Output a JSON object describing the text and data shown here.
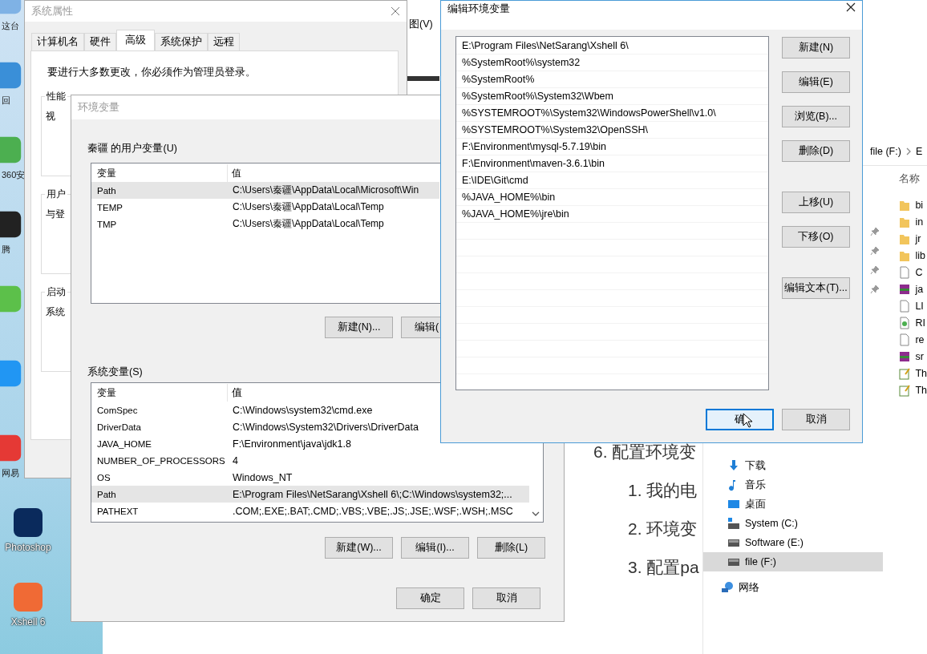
{
  "desktop_icons": [
    {
      "label": "这台",
      "color": "#7fb2e5"
    },
    {
      "label": "回",
      "color": "#3a8fd8"
    },
    {
      "label": "360安",
      "color": "#4caf50"
    },
    {
      "label": "腾",
      "color": "#222222"
    },
    {
      "color": "#5cc04a"
    },
    {
      "color": "#2196f3"
    },
    {
      "label": "网易",
      "color": "#e53935"
    },
    {
      "label": "Photoshop",
      "color": "#0a2a5c"
    },
    {
      "label": "Xshell 6",
      "color": "#f06a35"
    }
  ],
  "document": {
    "menu_label": "图(V)",
    "heading": "6. 配置环境变",
    "steps": [
      "1. 我的电",
      "2. 环境变",
      "3. 配置pa"
    ]
  },
  "explorer": {
    "breadcrumb": [
      "file (F:)",
      "E"
    ],
    "column_header": "名称",
    "files": [
      {
        "name": "bi",
        "kind": "folder"
      },
      {
        "name": "in",
        "kind": "folder"
      },
      {
        "name": "jr",
        "kind": "folder"
      },
      {
        "name": "lib",
        "kind": "folder"
      },
      {
        "name": "C",
        "kind": "file"
      },
      {
        "name": "ja",
        "kind": "archive"
      },
      {
        "name": "LI",
        "kind": "file"
      },
      {
        "name": "RI",
        "kind": "web"
      },
      {
        "name": "re",
        "kind": "file"
      },
      {
        "name": "sr",
        "kind": "archive"
      },
      {
        "name": "Th",
        "kind": "text"
      },
      {
        "name": "Th",
        "kind": "text"
      }
    ],
    "nav_items": [
      {
        "label": "下载",
        "kind": "download",
        "selected": false
      },
      {
        "label": "音乐",
        "kind": "music",
        "selected": false
      },
      {
        "label": "桌面",
        "kind": "desktop",
        "selected": false
      },
      {
        "label": "System (C:)",
        "kind": "system-drive",
        "selected": false
      },
      {
        "label": "Software (E:)",
        "kind": "drive",
        "selected": false
      },
      {
        "label": "file (F:)",
        "kind": "drive",
        "selected": true
      }
    ],
    "network": {
      "label": "网络"
    }
  },
  "system_properties": {
    "title": "系统属性",
    "tabs": [
      {
        "label": "计算机名",
        "selected": false
      },
      {
        "label": "硬件",
        "selected": false
      },
      {
        "label": "高级",
        "selected": true
      },
      {
        "label": "系统保护",
        "selected": false
      },
      {
        "label": "远程",
        "selected": false
      }
    ],
    "notice": "要进行大多数更改，你必须作为管理员登录。",
    "groups": [
      {
        "label": "性能",
        "text": "视"
      },
      {
        "label": "用户",
        "text": "与登"
      },
      {
        "label": "启动",
        "text": "系统"
      }
    ]
  },
  "env_vars": {
    "title": "环境变量",
    "user_label": "秦疆 的用户变量(U)",
    "user_columns": [
      "变量",
      "值"
    ],
    "user_rows": [
      {
        "name": "Path",
        "value": "C:\\Users\\秦疆\\AppData\\Local\\Microsoft\\Win",
        "selected": true
      },
      {
        "name": "TEMP",
        "value": "C:\\Users\\秦疆\\AppData\\Local\\Temp",
        "selected": false
      },
      {
        "name": "TMP",
        "value": "C:\\Users\\秦疆\\AppData\\Local\\Temp",
        "selected": false
      }
    ],
    "user_buttons": [
      "新建(N)...",
      "编辑("
    ],
    "system_label": "系统变量(S)",
    "system_columns": [
      "变量",
      "值"
    ],
    "system_rows": [
      {
        "name": "ComSpec",
        "value": "C:\\Windows\\system32\\cmd.exe",
        "selected": false
      },
      {
        "name": "DriverData",
        "value": "C:\\Windows\\System32\\Drivers\\DriverData",
        "selected": false
      },
      {
        "name": "JAVA_HOME",
        "value": "F:\\Environment\\java\\jdk1.8",
        "selected": false
      },
      {
        "name": "NUMBER_OF_PROCESSORS",
        "value": "4",
        "selected": false
      },
      {
        "name": "OS",
        "value": "Windows_NT",
        "selected": false
      },
      {
        "name": "Path",
        "value": "E:\\Program Files\\NetSarang\\Xshell 6\\;C:\\Windows\\system32;...",
        "selected": true
      },
      {
        "name": "PATHEXT",
        "value": ".COM;.EXE;.BAT;.CMD;.VBS;.VBE;.JS;.JSE;.WSF;.WSH;.MSC",
        "selected": false
      }
    ],
    "system_buttons": [
      "新建(W)...",
      "编辑(I)...",
      "删除(L)"
    ],
    "dialog_buttons": [
      "确定",
      "取消"
    ]
  },
  "edit_env": {
    "title": "编辑环境变量",
    "entries": [
      "E:\\Program Files\\NetSarang\\Xshell 6\\",
      "%SystemRoot%\\system32",
      "%SystemRoot%",
      "%SystemRoot%\\System32\\Wbem",
      "%SYSTEMROOT%\\System32\\WindowsPowerShell\\v1.0\\",
      "%SYSTEMROOT%\\System32\\OpenSSH\\",
      "F:\\Environment\\mysql-5.7.19\\bin",
      "F:\\Environment\\maven-3.6.1\\bin",
      "E:\\IDE\\Git\\cmd",
      "%JAVA_HOME%\\bin",
      "%JAVA_HOME%\\jre\\bin"
    ],
    "side_buttons": [
      [
        "新建(N)",
        "编辑(E)",
        "浏览(B)...",
        "删除(D)"
      ],
      [
        "上移(U)",
        "下移(O)"
      ],
      [
        "编辑文本(T)..."
      ]
    ],
    "dialog_buttons": [
      {
        "label": "确",
        "focused": true
      },
      {
        "label": "取消",
        "focused": false
      }
    ]
  }
}
